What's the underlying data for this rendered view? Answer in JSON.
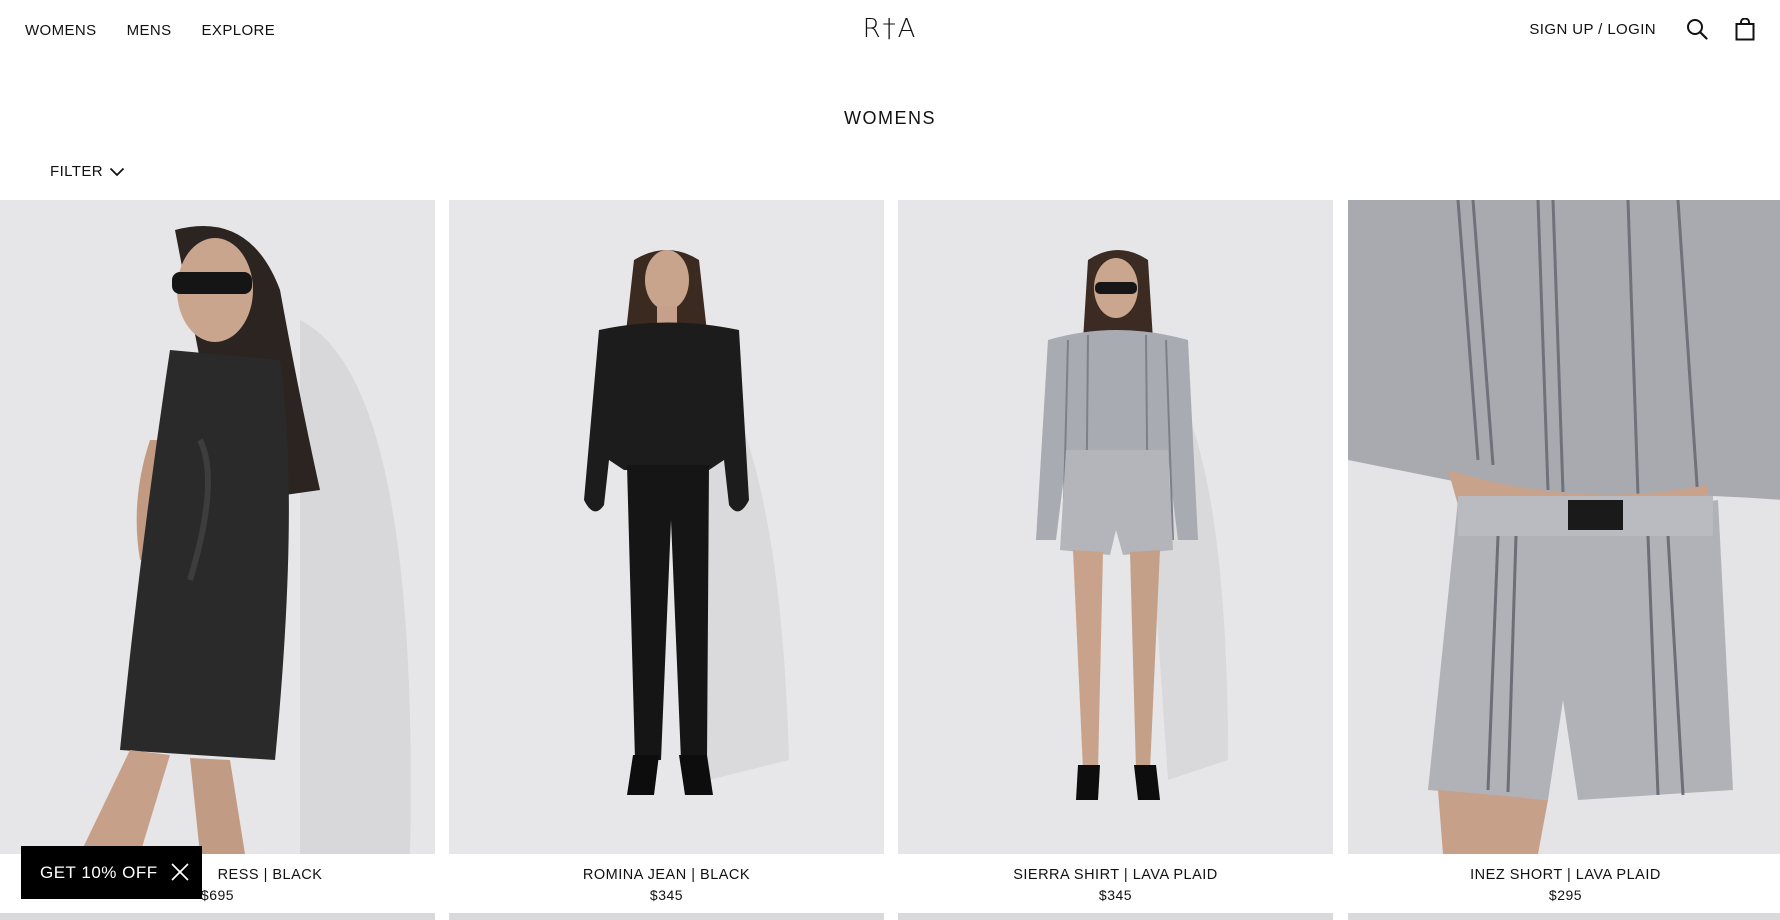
{
  "header": {
    "nav": [
      "WOMENS",
      "MENS",
      "EXPLORE"
    ],
    "logo": "R†A",
    "login_label": "SIGN UP / LOGIN",
    "icons": [
      "search-icon",
      "shopping-bag-icon"
    ]
  },
  "page": {
    "title": "WOMENS",
    "filter_label": "FILTER"
  },
  "products": [
    {
      "name": "RESS | BLACK",
      "price": "$695"
    },
    {
      "name": "ROMINA JEAN | BLACK",
      "price": "$345"
    },
    {
      "name": "SIERRA SHIRT | LAVA PLAID",
      "price": "$345"
    },
    {
      "name": "INEZ SHORT | LAVA PLAID",
      "price": "$295"
    }
  ],
  "promo": {
    "label": "GET 10% OFF"
  },
  "colors": {
    "text": "#111111",
    "background": "#ffffff",
    "promo_bg": "#000000",
    "photo_bg": "#e4e4e6"
  }
}
